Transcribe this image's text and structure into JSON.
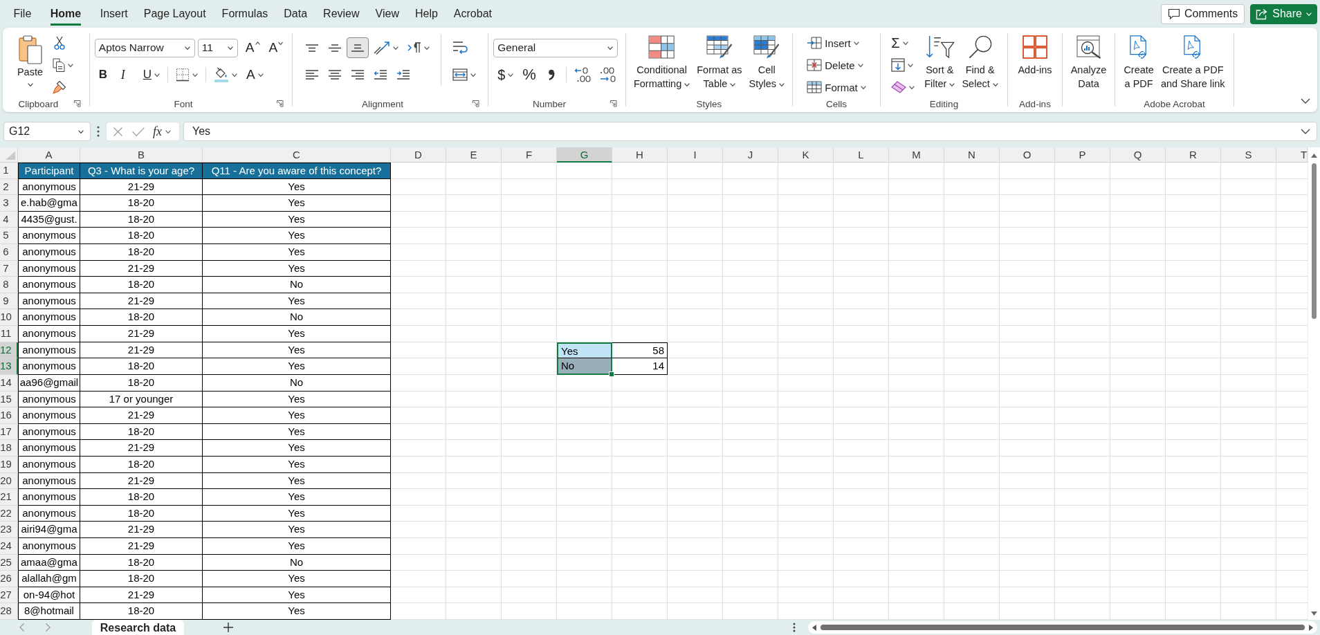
{
  "menu_tabs": [
    {
      "label": "File",
      "selected": false
    },
    {
      "label": "Home",
      "selected": true
    },
    {
      "label": "Insert",
      "selected": false
    },
    {
      "label": "Page Layout",
      "selected": false
    },
    {
      "label": "Formulas",
      "selected": false
    },
    {
      "label": "Data",
      "selected": false
    },
    {
      "label": "Review",
      "selected": false
    },
    {
      "label": "View",
      "selected": false
    },
    {
      "label": "Help",
      "selected": false
    },
    {
      "label": "Acrobat",
      "selected": false
    }
  ],
  "title_actions": [
    {
      "kind": "comments",
      "label": "Comments"
    },
    {
      "kind": "share",
      "label": "Share",
      "dropdown": true
    }
  ],
  "ribbon": {
    "groups": [
      {
        "label": "Clipboard",
        "launcher": true,
        "sections": [
          {
            "kind": "large",
            "items": [
              {
                "kind": "paste",
                "lines": [
                  "Paste"
                ],
                "dropdown": true
              }
            ]
          },
          {
            "kind": "stack",
            "rows": [
              {
                "tools": [
                  {
                    "kind": "cut"
                  }
                ]
              },
              {
                "tools": [
                  {
                    "kind": "copy",
                    "dropdown": true
                  }
                ]
              },
              {
                "tools": [
                  {
                    "kind": "painter"
                  }
                ]
              }
            ]
          }
        ]
      },
      {
        "label": "Font",
        "launcher": true,
        "sections": [
          {
            "kind": "stack",
            "rows": [
              {
                "tools": [
                  {
                    "kind": "fontname",
                    "value": "Aptos Narrow"
                  },
                  {
                    "kind": "fontsize",
                    "value": "11"
                  },
                  {
                    "kind": "grow",
                    "label": "A"
                  },
                  {
                    "kind": "shrink",
                    "label": "A"
                  }
                ]
              },
              {
                "tools": [
                  {
                    "kind": "bold",
                    "label": "B",
                    "pressed": false
                  },
                  {
                    "kind": "italic",
                    "label": "I",
                    "pressed": false
                  },
                  {
                    "kind": "underline",
                    "label": "U",
                    "pressed": false,
                    "dropdown": true
                  },
                  {
                    "kind": "borders",
                    "dropdown": true
                  },
                  {
                    "kind": "fillcolor",
                    "dropdown": true
                  },
                  {
                    "kind": "fontcolor",
                    "label": "A",
                    "dropdown": true
                  }
                ]
              }
            ]
          }
        ]
      },
      {
        "label": "Alignment",
        "launcher": true,
        "sections": [
          {
            "kind": "stack",
            "rows": [
              {
                "tools": [
                  {
                    "kind": "aligntop",
                    "pressed": false
                  },
                  {
                    "kind": "alignmiddle",
                    "pressed": false
                  },
                  {
                    "kind": "alignbottom",
                    "pressed": true
                  },
                  {
                    "kind": "orientation",
                    "dropdown": true
                  },
                  {
                    "kind": "direction",
                    "dropdown": true
                  }
                ]
              },
              {
                "tools": [
                  {
                    "kind": "alignleft",
                    "pressed": false
                  },
                  {
                    "kind": "aligncenter",
                    "pressed": false
                  },
                  {
                    "kind": "alignright",
                    "pressed": false
                  },
                  {
                    "kind": "outdent"
                  },
                  {
                    "kind": "indent"
                  }
                ]
              }
            ]
          },
          {
            "kind": "stack",
            "rows": [
              {
                "tools": [
                  {
                    "kind": "wrap",
                    "pressed": false
                  }
                ]
              },
              {
                "tools": [
                  {
                    "kind": "merge",
                    "pressed": false,
                    "dropdown": true
                  }
                ]
              }
            ]
          }
        ]
      },
      {
        "label": "Number",
        "launcher": true,
        "sections": [
          {
            "kind": "stack",
            "rows": [
              {
                "tools": [
                  {
                    "kind": "numformat",
                    "value": "General"
                  }
                ]
              },
              {
                "tools": [
                  {
                    "kind": "currency",
                    "label": "$",
                    "dropdown": true
                  },
                  {
                    "kind": "percent",
                    "label": "%"
                  },
                  {
                    "kind": "comma"
                  },
                  {
                    "kind": "moredecimals"
                  },
                  {
                    "kind": "fewerdecimals"
                  }
                ]
              }
            ]
          }
        ]
      },
      {
        "label": "Styles",
        "sections": [
          {
            "kind": "large",
            "items": [
              {
                "kind": "conditional",
                "lines": [
                  "Conditional",
                  "Formatting"
                ],
                "dropdown": true
              },
              {
                "kind": "table",
                "lines": [
                  "Format as",
                  "Table"
                ],
                "dropdown": true
              },
              {
                "kind": "cellstyles",
                "lines": [
                  "Cell",
                  "Styles"
                ],
                "dropdown": true
              }
            ]
          }
        ]
      },
      {
        "label": "Cells",
        "sections": [
          {
            "kind": "stack",
            "rows": [
              {
                "tools": [
                  {
                    "kind": "insert",
                    "label": "Insert",
                    "dropdown": true
                  }
                ]
              },
              {
                "tools": [
                  {
                    "kind": "delete",
                    "label": "Delete",
                    "dropdown": true
                  }
                ]
              },
              {
                "tools": [
                  {
                    "kind": "cellformat",
                    "label": "Format",
                    "dropdown": true
                  }
                ]
              }
            ]
          }
        ]
      },
      {
        "label": "Editing",
        "sections": [
          {
            "kind": "stack",
            "rows": [
              {
                "tools": [
                  {
                    "kind": "autosum",
                    "label": "Σ",
                    "dropdown": true
                  }
                ]
              },
              {
                "tools": [
                  {
                    "kind": "filldown",
                    "dropdown": true
                  }
                ]
              },
              {
                "tools": [
                  {
                    "kind": "clear",
                    "dropdown": true
                  }
                ]
              }
            ]
          },
          {
            "kind": "large",
            "items": [
              {
                "kind": "sort",
                "lines": [
                  "Sort &",
                  "Filter"
                ],
                "dropdown": true
              },
              {
                "kind": "find",
                "lines": [
                  "Find &",
                  "Select"
                ],
                "dropdown": true
              }
            ]
          }
        ]
      },
      {
        "label": "Add-ins",
        "sections": [
          {
            "kind": "large",
            "items": [
              {
                "kind": "addins",
                "lines": [
                  "Add-ins"
                ]
              }
            ]
          }
        ]
      },
      {
        "sections": [
          {
            "kind": "large",
            "items": [
              {
                "kind": "analyze",
                "lines": [
                  "Analyze",
                  "Data"
                ]
              }
            ]
          }
        ]
      },
      {
        "label": "Adobe Acrobat",
        "sections": [
          {
            "kind": "large",
            "items": [
              {
                "kind": "createpdf",
                "lines": [
                  "Create",
                  "a PDF"
                ]
              },
              {
                "kind": "sharepdf",
                "lines": [
                  "Create a PDF",
                  "and Share link"
                ]
              }
            ]
          }
        ]
      }
    ]
  },
  "formula_bar": {
    "name_box": "G12",
    "function_label": "fx",
    "value": "Yes"
  },
  "sheet": {
    "columns": [
      {
        "label": "A",
        "selected": false
      },
      {
        "label": "B",
        "selected": false
      },
      {
        "label": "C",
        "selected": false
      },
      {
        "label": "D",
        "selected": false
      },
      {
        "label": "E",
        "selected": false
      },
      {
        "label": "F",
        "selected": false
      },
      {
        "label": "G",
        "selected": true
      },
      {
        "label": "H",
        "selected": false
      },
      {
        "label": "I",
        "selected": false
      },
      {
        "label": "J",
        "selected": false
      },
      {
        "label": "K",
        "selected": false
      },
      {
        "label": "L",
        "selected": false
      },
      {
        "label": "M",
        "selected": false
      },
      {
        "label": "N",
        "selected": false
      },
      {
        "label": "O",
        "selected": false
      },
      {
        "label": "P",
        "selected": false
      },
      {
        "label": "Q",
        "selected": false
      },
      {
        "label": "R",
        "selected": false
      },
      {
        "label": "S",
        "selected": false
      },
      {
        "label": "T",
        "selected": false
      }
    ],
    "rows": [
      {
        "label": "1",
        "selected": false,
        "cells": [
          "Participant",
          "Q3 - What is your age?",
          "Q11 - Are you aware of this concept?"
        ]
      },
      {
        "label": "2",
        "selected": false,
        "cells": [
          "anonymous",
          "21-29",
          "Yes"
        ]
      },
      {
        "label": "3",
        "selected": false,
        "cells": [
          "e.hab@gma",
          "18-20",
          "Yes"
        ]
      },
      {
        "label": "4",
        "selected": false,
        "cells": [
          "4435@gust.",
          "18-20",
          "Yes"
        ]
      },
      {
        "label": "5",
        "selected": false,
        "cells": [
          "anonymous",
          "18-20",
          "Yes"
        ]
      },
      {
        "label": "6",
        "selected": false,
        "cells": [
          "anonymous",
          "18-20",
          "Yes"
        ]
      },
      {
        "label": "7",
        "selected": false,
        "cells": [
          "anonymous",
          "21-29",
          "Yes"
        ]
      },
      {
        "label": "8",
        "selected": false,
        "cells": [
          "anonymous",
          "18-20",
          "No"
        ]
      },
      {
        "label": "9",
        "selected": false,
        "cells": [
          "anonymous",
          "21-29",
          "Yes"
        ]
      },
      {
        "label": "10",
        "selected": false,
        "cells": [
          "anonymous",
          "18-20",
          "No"
        ]
      },
      {
        "label": "11",
        "selected": false,
        "cells": [
          "anonymous",
          "21-29",
          "Yes"
        ]
      },
      {
        "label": "12",
        "selected": true,
        "cells": [
          "anonymous",
          "21-29",
          "Yes"
        ],
        "summary": [
          {
            "text": "Yes",
            "color": "#c0e4f5",
            "selected": true
          },
          {
            "text": "58",
            "selected": false
          }
        ]
      },
      {
        "label": "13",
        "selected": true,
        "cells": [
          "anonymous",
          "18-20",
          "Yes"
        ],
        "summary": [
          {
            "text": "No",
            "color": "#98aeb9",
            "selected": true
          },
          {
            "text": "14",
            "selected": false
          }
        ]
      },
      {
        "label": "14",
        "selected": false,
        "cells": [
          "aa96@gmail",
          "18-20",
          "No"
        ]
      },
      {
        "label": "15",
        "selected": false,
        "cells": [
          "anonymous",
          "17 or younger",
          "Yes"
        ]
      },
      {
        "label": "16",
        "selected": false,
        "cells": [
          "anonymous",
          "21-29",
          "Yes"
        ]
      },
      {
        "label": "17",
        "selected": false,
        "cells": [
          "anonymous",
          "18-20",
          "Yes"
        ]
      },
      {
        "label": "18",
        "selected": false,
        "cells": [
          "anonymous",
          "21-29",
          "Yes"
        ]
      },
      {
        "label": "19",
        "selected": false,
        "cells": [
          "anonymous",
          "18-20",
          "Yes"
        ]
      },
      {
        "label": "20",
        "selected": false,
        "cells": [
          "anonymous",
          "21-29",
          "Yes"
        ]
      },
      {
        "label": "21",
        "selected": false,
        "cells": [
          "anonymous",
          "18-20",
          "Yes"
        ]
      },
      {
        "label": "22",
        "selected": false,
        "cells": [
          "anonymous",
          "18-20",
          "Yes"
        ]
      },
      {
        "label": "23",
        "selected": false,
        "cells": [
          "airi94@gma",
          "21-29",
          "Yes"
        ]
      },
      {
        "label": "24",
        "selected": false,
        "cells": [
          "anonymous",
          "21-29",
          "Yes"
        ]
      },
      {
        "label": "25",
        "selected": false,
        "cells": [
          "amaa@gma",
          "18-20",
          "No"
        ]
      },
      {
        "label": "26",
        "selected": false,
        "cells": [
          "alallah@gm",
          "18-20",
          "Yes"
        ]
      },
      {
        "label": "27",
        "selected": false,
        "cells": [
          "on-94@hot",
          "21-29",
          "Yes"
        ]
      },
      {
        "label": "28",
        "selected": false,
        "cells": [
          "8@hotmail",
          "18-20",
          "Yes"
        ]
      }
    ]
  },
  "sheet_tabs": [
    {
      "label": "Research data",
      "selected": true
    }
  ]
}
